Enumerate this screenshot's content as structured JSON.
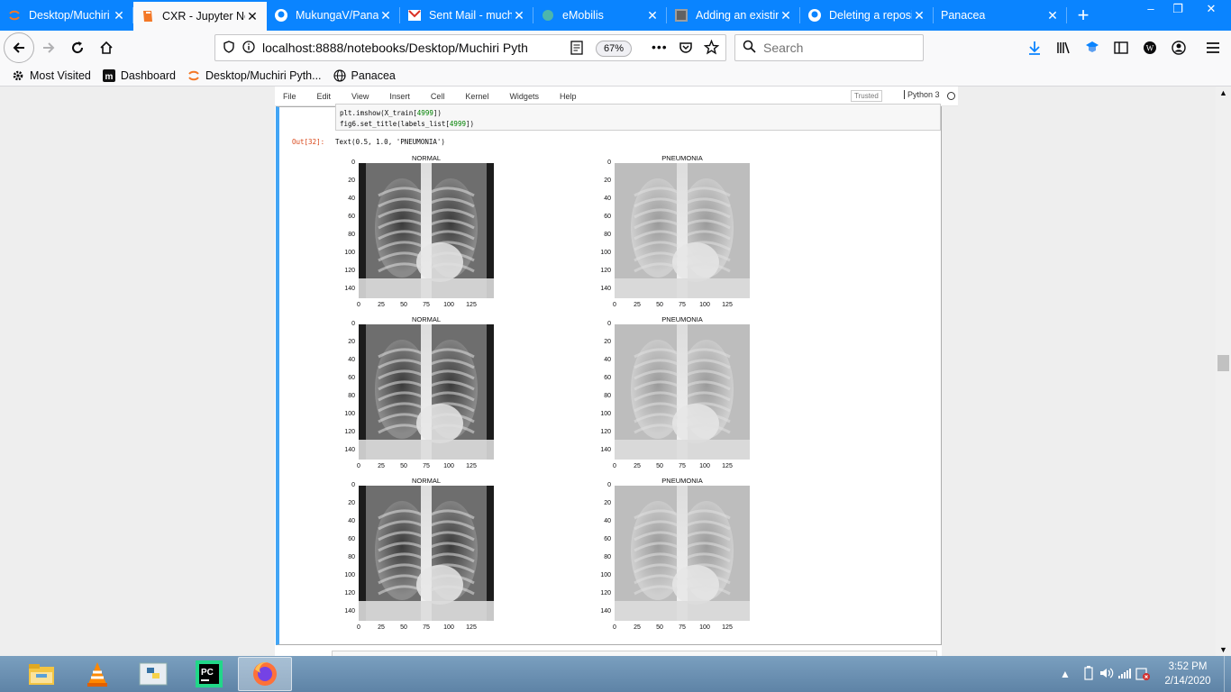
{
  "browser": {
    "tabs": [
      {
        "title": "Desktop/Muchiri Pyth",
        "icon": "jupyter-icon",
        "active": false
      },
      {
        "title": "CXR - Jupyter Notebook",
        "icon": "jupyter-notebook-icon",
        "active": true
      },
      {
        "title": "MukungaV/Panacea",
        "icon": "github-icon",
        "active": false
      },
      {
        "title": "Sent Mail - muchiri",
        "icon": "gmail-icon",
        "active": false
      },
      {
        "title": "eMobilis",
        "icon": "globe-icon",
        "active": false
      },
      {
        "title": "Adding an existing",
        "icon": "page-icon",
        "active": false
      },
      {
        "title": "Deleting a repository",
        "icon": "github-icon",
        "active": false
      },
      {
        "title": "Panacea",
        "icon": "none",
        "active": false
      }
    ],
    "url": "localhost:8888/notebooks/Desktop/Muchiri Pyth",
    "zoom": "67%",
    "search_placeholder": "Search",
    "bookmarks": [
      {
        "label": "Most Visited",
        "icon": "gear-icon"
      },
      {
        "label": "Dashboard",
        "icon": "m-logo-icon"
      },
      {
        "label": "Desktop/Muchiri Pyth...",
        "icon": "jupyter-icon"
      },
      {
        "label": "Panacea",
        "icon": "globe-icon"
      }
    ]
  },
  "jupyter": {
    "menu": [
      "File",
      "Edit",
      "View",
      "Insert",
      "Cell",
      "Kernel",
      "Widgets",
      "Help"
    ],
    "trusted": "Trusted",
    "kernel": "Python 3",
    "code_line1_prefix": "plt.imshow(X_train[",
    "code_line1_num": "4999",
    "code_line1_suffix": "])",
    "code_line2_prefix": "fig6.set_title(labels_list[",
    "code_line2_num": "4999",
    "code_line2_suffix": "])",
    "out_prompt": "Out[32]:",
    "out_text": "Text(0.5, 1.0, 'PNEUMONIA')",
    "subplots": [
      {
        "title": "NORMAL"
      },
      {
        "title": "PNEUMONIA"
      },
      {
        "title": "NORMAL"
      },
      {
        "title": "PNEUMONIA"
      },
      {
        "title": "NORMAL"
      },
      {
        "title": "PNEUMONIA"
      }
    ],
    "yticks": [
      "0",
      "20",
      "40",
      "60",
      "80",
      "100",
      "120",
      "140"
    ],
    "xticks": [
      "0",
      "25",
      "50",
      "75",
      "100",
      "125"
    ]
  },
  "taskbar": {
    "apps": [
      "file-explorer-icon",
      "vlc-icon",
      "python-idle-icon",
      "pycharm-icon",
      "firefox-icon"
    ],
    "time": "3:52 PM",
    "date": "2/14/2020"
  }
}
